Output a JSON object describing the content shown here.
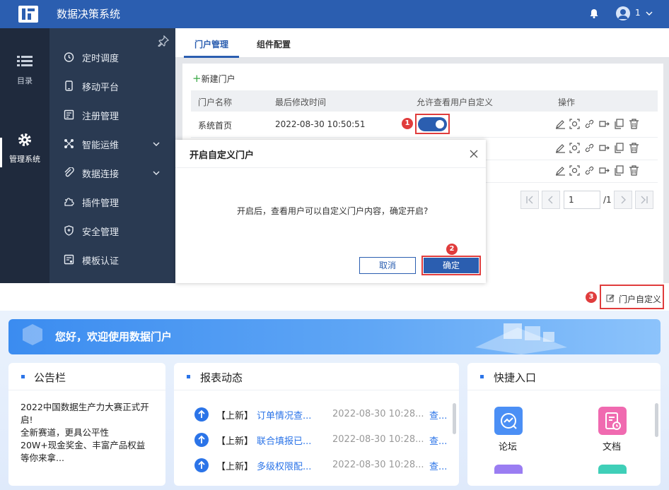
{
  "header": {
    "title": "数据决策系统",
    "user": "1"
  },
  "rail": {
    "items": [
      {
        "label": "目录"
      },
      {
        "label": "管理系统"
      }
    ]
  },
  "sidebar": {
    "items": [
      {
        "label": "定时调度"
      },
      {
        "label": "移动平台"
      },
      {
        "label": "注册管理"
      },
      {
        "label": "智能运维"
      },
      {
        "label": "数据连接"
      },
      {
        "label": "插件管理"
      },
      {
        "label": "安全管理"
      },
      {
        "label": "模板认证"
      }
    ]
  },
  "tabs": [
    {
      "label": "门户管理"
    },
    {
      "label": "组件配置"
    }
  ],
  "toolbar": {
    "new_portal": "新建门户"
  },
  "table": {
    "headers": [
      "门户名称",
      "最后修改时间",
      "允许查看用户自定义",
      "操作"
    ],
    "rows": [
      {
        "name": "系统首页",
        "modified": "2022-08-30 10:50:51",
        "allow_custom": true
      }
    ]
  },
  "pagination": {
    "page": "1",
    "total": "/1"
  },
  "modal": {
    "title": "开启自定义门户",
    "message": "开启后，查看用户可以自定义门户内容，确定开启?",
    "cancel": "取消",
    "ok": "确定"
  },
  "steps": [
    "1",
    "2",
    "3"
  ],
  "portal": {
    "customize_label": "门户自定义",
    "banner": "您好，欢迎使用数据门户",
    "notice": {
      "title": "公告栏",
      "lines": [
        "2022中国数据生产力大赛正式开",
        "启!",
        "全新赛道，更具公平性",
        "20W+现金奖金、丰富产品权益",
        "等你来拿..."
      ]
    },
    "reports": {
      "title": "报表动态",
      "items": [
        {
          "tag": "【上新】",
          "link": "订单情况查...",
          "date": "2022-08-30 10:28...",
          "view": "查..."
        },
        {
          "tag": "【上新】",
          "link": "联合填报已...",
          "date": "2022-08-30 10:28...",
          "view": "查..."
        },
        {
          "tag": "【上新】",
          "link": "多级权限配...",
          "date": "2022-08-30 10:28...",
          "view": "查..."
        }
      ]
    },
    "quick": {
      "title": "快捷入口",
      "items": [
        {
          "label": "论坛",
          "color": "#4b8ff5"
        },
        {
          "label": "文档",
          "color": "#f06ab0"
        }
      ]
    }
  },
  "colors": {
    "brand": "#2b5eb0",
    "highlight": "#e03c3c"
  }
}
